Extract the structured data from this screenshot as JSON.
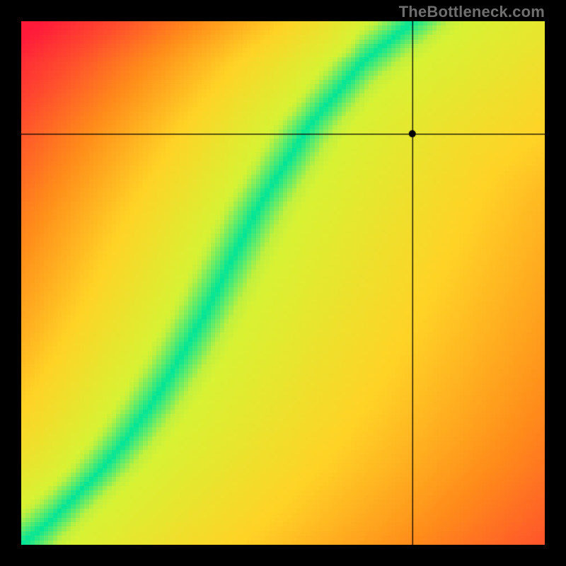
{
  "watermark": "TheBottleneck.com",
  "chart_data": {
    "type": "heatmap",
    "title": "",
    "xlabel": "",
    "ylabel": "",
    "normalized_units": "0-1 on each axis, origin at bottom-left",
    "description": "Bottleneck heatmap. Green diagonal band indicates balanced optimum; color ramps through yellow→orange→red as combination diverges from the optimum. A black crosshair marks a specific point.",
    "optimal_ridge_points": [
      {
        "x": 0.0,
        "y": 0.0
      },
      {
        "x": 0.05,
        "y": 0.04
      },
      {
        "x": 0.1,
        "y": 0.09
      },
      {
        "x": 0.15,
        "y": 0.14
      },
      {
        "x": 0.2,
        "y": 0.2
      },
      {
        "x": 0.25,
        "y": 0.27
      },
      {
        "x": 0.3,
        "y": 0.35
      },
      {
        "x": 0.35,
        "y": 0.44
      },
      {
        "x": 0.4,
        "y": 0.54
      },
      {
        "x": 0.45,
        "y": 0.64
      },
      {
        "x": 0.5,
        "y": 0.72
      },
      {
        "x": 0.55,
        "y": 0.8
      },
      {
        "x": 0.6,
        "y": 0.86
      },
      {
        "x": 0.65,
        "y": 0.92
      },
      {
        "x": 0.7,
        "y": 0.96
      },
      {
        "x": 0.75,
        "y": 1.0
      }
    ],
    "green_band_half_width": 0.055,
    "marker": {
      "x": 0.747,
      "y": 0.785
    },
    "color_stops": [
      {
        "t": 0.0,
        "hex": "#00e598"
      },
      {
        "t": 0.18,
        "hex": "#d8f233"
      },
      {
        "t": 0.4,
        "hex": "#ffd226"
      },
      {
        "t": 0.62,
        "hex": "#ff8c1a"
      },
      {
        "t": 0.82,
        "hex": "#ff4a2e"
      },
      {
        "t": 1.0,
        "hex": "#ff1a3a"
      }
    ],
    "xlim": [
      0,
      1
    ],
    "ylim": [
      0,
      1
    ]
  }
}
